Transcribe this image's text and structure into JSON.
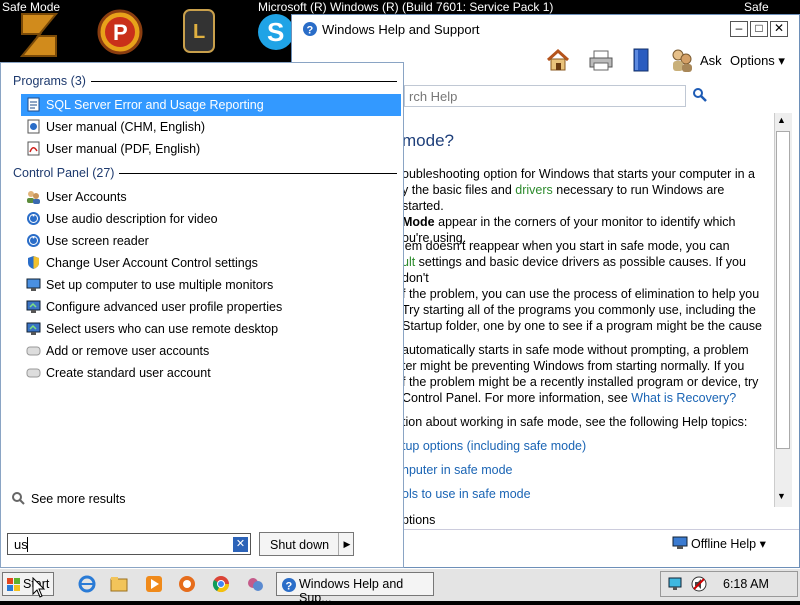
{
  "desktop": {
    "left_title": "Safe Mode",
    "center_title": "Microsoft (R) Windows (R) (Build 7601: Service Pack 1)",
    "right_title": "Safe Mode"
  },
  "help_window": {
    "title": "Windows Help and Support",
    "toolbar": {
      "ask": "Ask",
      "options": "Options"
    },
    "search_placeholder": "rch Help",
    "heading": "mode?",
    "para1": [
      "oubleshooting option for Windows that starts your computer in a",
      "y the basic files and ",
      "drivers",
      " necessary to run Windows are started.",
      "Mode",
      " appear in the corners of your monitor to identify which",
      "ou're using."
    ],
    "para2": [
      "lem doesn't reappear when you start in safe mode, you can",
      "ult",
      " settings and basic device drivers as possible causes. If you don't",
      "f the problem, you can use the process of elimination to help you",
      " Try starting all of the programs you commonly use, including the",
      " Startup folder, one by one to see if a program might be the cause"
    ],
    "para3": [
      "automatically starts in safe mode without prompting, a problem",
      "ter might be preventing Windows from starting normally. If you",
      "f the problem might be a recently installed program or device, try",
      " Control Panel. For more information, see ",
      "What is Recovery?"
    ],
    "para4": "tion about working in safe mode, see the following Help topics:",
    "links": [
      "tup options (including safe mode)",
      "nputer in safe mode",
      "ols to use in safe mode"
    ],
    "bottom_options": "ptions",
    "offline_help": "Offline Help"
  },
  "start_menu": {
    "programs_header": "Programs (3)",
    "programs": [
      {
        "label": "SQL Server Error and Usage Reporting",
        "icon": "report-icon"
      },
      {
        "label": "User manual (CHM, English)",
        "icon": "help-file-icon"
      },
      {
        "label": "User manual (PDF, English)",
        "icon": "pdf-icon"
      }
    ],
    "control_header": "Control Panel (27)",
    "control_items": [
      {
        "label": "User Accounts",
        "icon": "users-icon"
      },
      {
        "label": "Use audio description for video",
        "icon": "ease-access-icon"
      },
      {
        "label": "Use screen reader",
        "icon": "ease-access-icon"
      },
      {
        "label": "Change User Account Control settings",
        "icon": "uac-shield-icon"
      },
      {
        "label": "Set up computer to use multiple monitors",
        "icon": "monitor-icon"
      },
      {
        "label": "Configure advanced user profile properties",
        "icon": "system-icon"
      },
      {
        "label": "Select users who can use remote desktop",
        "icon": "system-icon"
      },
      {
        "label": "Add or remove user accounts",
        "icon": "generic-item-icon"
      },
      {
        "label": "Create standard user account",
        "icon": "generic-item-icon"
      }
    ],
    "see_more": "See more results",
    "search_value": "us",
    "shutdown": "Shut down"
  },
  "taskbar": {
    "start": "Start",
    "task_help": "Windows Help and Sup...",
    "clock": "6:18 AM"
  },
  "colors": {
    "selection": "#3399ff",
    "link": "#1a64b4",
    "green_link": "#2c8a2c"
  }
}
